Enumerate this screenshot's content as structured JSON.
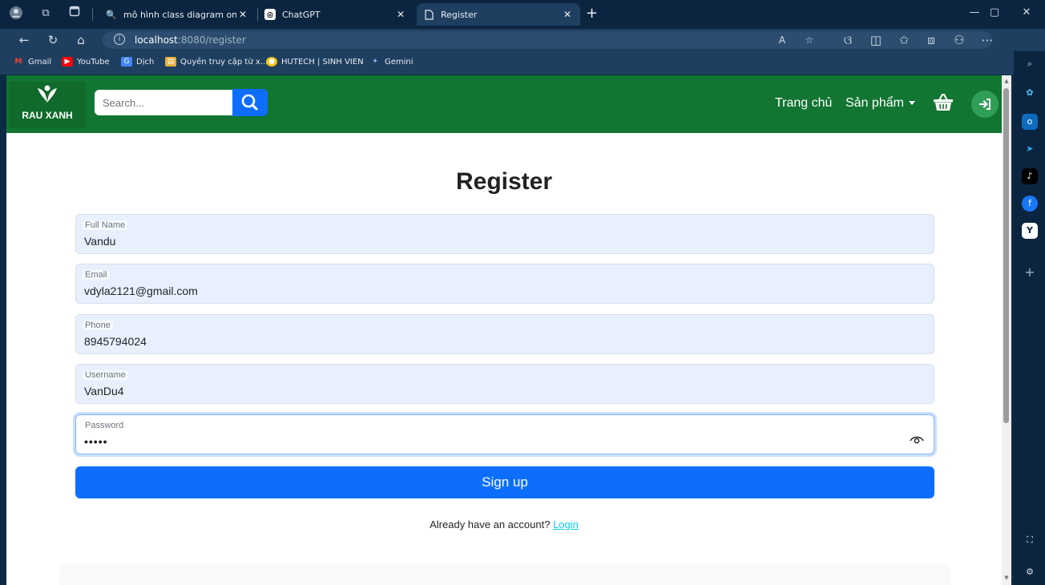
{
  "browser": {
    "tabs": [
      {
        "label": "mô hình class diagram online - T",
        "active": false
      },
      {
        "label": "ChatGPT",
        "active": false
      },
      {
        "label": "Register",
        "active": true
      }
    ],
    "url_host": "localhost",
    "url_path": ":8080/register",
    "bookmarks": [
      {
        "label": "Gmail",
        "icon": "gmail-icon"
      },
      {
        "label": "YouTube",
        "icon": "youtube-icon"
      },
      {
        "label": "Dịch",
        "icon": "translate-icon"
      },
      {
        "label": "Quyền truy cập từ x...",
        "icon": "folder-icon"
      },
      {
        "label": "HUTECH | SINH VIEN",
        "icon": "hutech-icon"
      },
      {
        "label": "Gemini",
        "icon": "gemini-icon"
      }
    ],
    "accent": "#1f3f60"
  },
  "site": {
    "brand": "RAU XANH",
    "search_placeholder": "Search...",
    "nav": {
      "home": "Trang chủ",
      "products": "Sản phẩm"
    },
    "header_color": "#127531"
  },
  "form": {
    "title": "Register",
    "fields": [
      {
        "label": "Full Name",
        "value": "Vandu"
      },
      {
        "label": "Email",
        "value": "vdyla2121@gmail.com"
      },
      {
        "label": "Phone",
        "value": "8945794024"
      },
      {
        "label": "Username",
        "value": "VanDu4"
      },
      {
        "label": "Password",
        "value": "•••••"
      }
    ],
    "submit_label": "Sign up",
    "footer_text": "Already have an account?",
    "login_link": "Login",
    "button_color": "#0d6efd"
  }
}
